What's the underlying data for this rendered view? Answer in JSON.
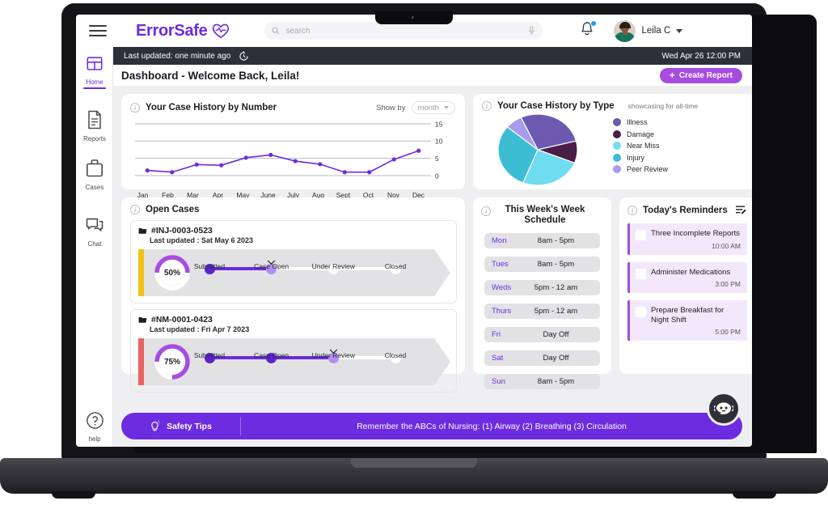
{
  "app": {
    "brand_name": "ErrorSafe",
    "brand_icon": "heart-pulse-icon"
  },
  "topbar": {
    "menu_icon": "hamburger-menu-icon",
    "search_placeholder": "search",
    "search_value": "",
    "search_icon": "search-icon",
    "mic_icon": "microphone-icon",
    "bell_icon": "notification-bell-icon",
    "user_name": "Leila C",
    "chevron_icon": "chevron-down-icon"
  },
  "statusbar": {
    "last_updated": "Last updated: one minute ago",
    "refresh_icon": "refresh-clock-icon",
    "datetime": "Wed Apr 26 12:00 PM"
  },
  "sidebar": {
    "items": [
      {
        "label": "Home",
        "icon": "dashboard-grid-icon",
        "active": true
      },
      {
        "label": "Reports",
        "icon": "document-page-icon",
        "active": false
      },
      {
        "label": "Cases",
        "icon": "briefcase-icon",
        "active": false
      },
      {
        "label": "Chat",
        "icon": "chat-bubbles-icon",
        "active": false
      }
    ],
    "help": {
      "label": "help",
      "icon": "question-circle-icon"
    }
  },
  "page": {
    "title": "Dashboard - Welcome Back, Leila!",
    "create_report_label": "Create Report",
    "create_report_icon": "plus-icon"
  },
  "line_card": {
    "title": "Your Case History by Number",
    "info_icon": "info-circle-icon",
    "show_by_label": "Show by",
    "show_by_value": "month",
    "dropdown_icon": "caret-down-icon"
  },
  "pie_card": {
    "title": "Your Case History by Type",
    "info_icon": "info-circle-icon",
    "subtitle": "showcasing for all-time"
  },
  "chart_data": [
    {
      "type": "line",
      "title": "Your Case History by Number",
      "xlabel": "",
      "ylabel": "",
      "categories": [
        "Jan",
        "Feb",
        "Mar",
        "Apr",
        "May",
        "June",
        "July",
        "Aug",
        "Sept",
        "Oct",
        "Nov",
        "Dec"
      ],
      "values": [
        1.5,
        1.0,
        3.2,
        3.0,
        5.2,
        6.0,
        4.2,
        3.3,
        1.0,
        1.0,
        4.7,
        7.2
      ],
      "ylim": [
        0,
        15
      ],
      "yticks": [
        0,
        5,
        10,
        15
      ],
      "grid": true,
      "legend": "none",
      "color": "#6d2ce0"
    },
    {
      "type": "pie",
      "title": "Your Case History by Type",
      "subtitle": "showcasing for all-time",
      "legend": "right",
      "labels": [
        "Illness",
        "Damage",
        "Near Miss",
        "Injury",
        "Peer Review"
      ],
      "values": [
        28,
        10,
        25,
        30,
        7
      ],
      "colors": [
        "#6b5ab0",
        "#4a1f47",
        "#6fdcf0",
        "#3cbdd4",
        "#a79bee"
      ]
    }
  ],
  "cases_card": {
    "title": "Open Cases",
    "info_icon": "info-circle-icon",
    "stages": [
      "Submitted",
      "Case Open",
      "Under Review",
      "Closed"
    ],
    "items": [
      {
        "folder_icon": "folder-icon",
        "case_id": "#INJ-0003-0523",
        "last_updated": "Last updated : Sat May 6 2023",
        "progress": "50%",
        "progress_value": 50,
        "current_stage_index": 1,
        "accent_color": "#f0c116",
        "ring_color": "#a64de0"
      },
      {
        "folder_icon": "folder-icon",
        "case_id": "#NM-0001-0423",
        "last_updated": "Last updated : Fri Apr 7 2023",
        "progress": "75%",
        "progress_value": 75,
        "current_stage_index": 2,
        "accent_color": "#e8645e",
        "ring_color": "#a64de0"
      }
    ]
  },
  "schedule_card": {
    "title": "This Week's Week Schedule",
    "info_icon": "info-circle-icon",
    "rows": [
      {
        "day": "Mon",
        "time": "8am - 5pm"
      },
      {
        "day": "Tues",
        "time": "8am - 5pm"
      },
      {
        "day": "Weds",
        "time": "5pm - 12 am"
      },
      {
        "day": "Thurs",
        "time": "5pm - 12 am"
      },
      {
        "day": "Fri",
        "time": "Day Off"
      },
      {
        "day": "Sat",
        "time": "Day Off"
      },
      {
        "day": "Sun",
        "time": "8am - 5pm"
      }
    ]
  },
  "reminders_card": {
    "title": "Today's Reminders",
    "info_icon": "info-circle-icon",
    "edit_icon": "edit-list-icon",
    "items": [
      {
        "text": "Three Incomplete Reports",
        "time": "10:00 AM",
        "checked": false
      },
      {
        "text": "Administer Medications",
        "time": "3:00 PM",
        "checked": false
      },
      {
        "text": "Prepare Breakfast for Night Shift",
        "time": "5:00 PM",
        "checked": false
      }
    ]
  },
  "tips_bar": {
    "label": "Safety Tips",
    "bulb_icon": "lightbulb-icon",
    "message": "Remember the ABCs of Nursing: (1) Airway (2) Breathing (3) Circulation"
  },
  "chatbot": {
    "icon": "chatbot-icon"
  },
  "colors": {
    "primary": "#6d2ce0",
    "accent": "#a64de0",
    "dark": "#2f2f3a",
    "content_bg": "#efeff1"
  }
}
